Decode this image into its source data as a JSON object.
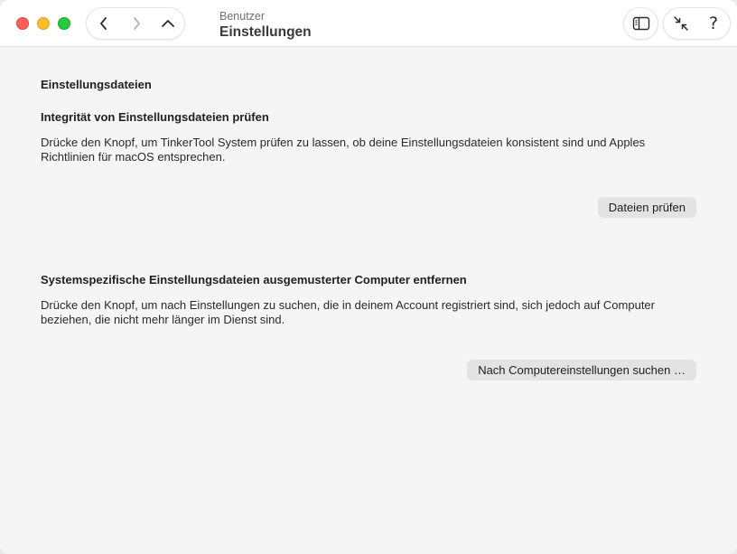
{
  "window": {
    "traffic_lights": [
      "close",
      "minimize",
      "zoom"
    ],
    "colors": {
      "close": "#ff5f57",
      "minimize": "#febc2e",
      "zoom": "#28c840"
    }
  },
  "toolbar": {
    "nav_icons": [
      "chevron-left-icon",
      "chevron-right-icon",
      "chevron-up-icon"
    ],
    "breadcrumb": "Benutzer",
    "title": "Einstellungen",
    "sidebar_icon": "sidebar-icon",
    "collapse_icon": "arrows-collapse-icon",
    "help_label": "?"
  },
  "main": {
    "page_heading": "Einstellungsdateien",
    "sections": [
      {
        "title": "Integrität von Einstellungsdateien prüfen",
        "description": "Drücke den Knopf, um TinkerTool System prüfen zu lassen, ob deine Einstellungsdateien konsistent sind und Apples Richtlinien für macOS entsprechen.",
        "button_label": "Dateien prüfen"
      },
      {
        "title": "Systemspezifische Einstellungsdateien ausgemusterter Computer entfernen",
        "description": "Drücke den Knopf, um nach Einstellungen zu suchen, die in deinem Account registriert sind, sich jedoch auf Computer beziehen, die nicht mehr länger im Dienst sind.",
        "button_label": "Nach Computereinstellungen suchen …"
      }
    ]
  }
}
